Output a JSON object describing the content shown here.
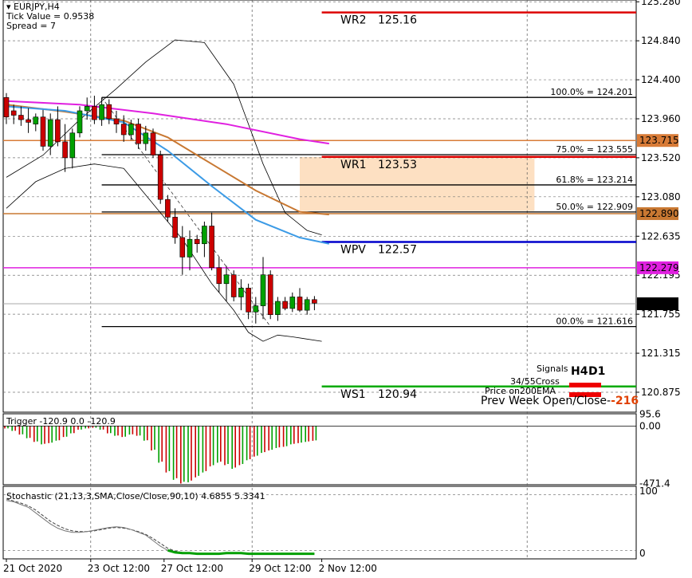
{
  "chart_data": {
    "type": "candlestick",
    "symbol": "EURJPY,H4",
    "tick_value_label": "Tick Value = 0.9538",
    "spread_label": "Spread = 7",
    "ylim": [
      120.65,
      125.3
    ],
    "price_ticks": [
      "125.280",
      "124.840",
      "124.400",
      "123.960",
      "123.520",
      "123.080",
      "122.635",
      "122.195",
      "121.755",
      "121.315",
      "120.875"
    ],
    "time_labels": [
      {
        "label": "21 Oct 2020",
        "x": 0
      },
      {
        "label": "23 Oct 12:00",
        "x": 11.5
      },
      {
        "label": "27 Oct 12:00",
        "x": 21.5
      },
      {
        "label": "29 Oct 12:00",
        "x": 33.5
      },
      {
        "label": "2 Nov 12:00",
        "x": 43
      }
    ],
    "vertical_gridlines_x": [
      11.5,
      33.5
    ],
    "candles": [
      {
        "o": 124.2,
        "h": 124.25,
        "l": 123.9,
        "c": 123.98
      },
      {
        "o": 124.05,
        "h": 124.12,
        "l": 123.9,
        "c": 124.0
      },
      {
        "o": 124.0,
        "h": 124.1,
        "l": 123.88,
        "c": 123.95
      },
      {
        "o": 123.95,
        "h": 124.08,
        "l": 123.8,
        "c": 123.92
      },
      {
        "o": 123.9,
        "h": 124.02,
        "l": 123.82,
        "c": 123.98
      },
      {
        "o": 123.98,
        "h": 124.06,
        "l": 123.6,
        "c": 123.65
      },
      {
        "o": 123.65,
        "h": 124.02,
        "l": 123.55,
        "c": 123.95
      },
      {
        "o": 123.95,
        "h": 124.1,
        "l": 123.65,
        "c": 123.7
      },
      {
        "o": 123.7,
        "h": 123.9,
        "l": 123.36,
        "c": 123.52
      },
      {
        "o": 123.52,
        "h": 123.85,
        "l": 123.4,
        "c": 123.8
      },
      {
        "o": 123.8,
        "h": 124.1,
        "l": 123.75,
        "c": 124.05
      },
      {
        "o": 124.05,
        "h": 124.2,
        "l": 123.95,
        "c": 124.1
      },
      {
        "o": 124.1,
        "h": 124.22,
        "l": 123.9,
        "c": 123.95
      },
      {
        "o": 123.95,
        "h": 124.2,
        "l": 123.88,
        "c": 124.12
      },
      {
        "o": 124.12,
        "h": 124.18,
        "l": 123.9,
        "c": 123.96
      },
      {
        "o": 123.96,
        "h": 124.05,
        "l": 123.8,
        "c": 123.9
      },
      {
        "o": 123.9,
        "h": 124.0,
        "l": 123.7,
        "c": 123.78
      },
      {
        "o": 123.78,
        "h": 123.95,
        "l": 123.72,
        "c": 123.9
      },
      {
        "o": 123.9,
        "h": 123.96,
        "l": 123.62,
        "c": 123.68
      },
      {
        "o": 123.68,
        "h": 123.88,
        "l": 123.6,
        "c": 123.8
      },
      {
        "o": 123.8,
        "h": 123.85,
        "l": 123.52,
        "c": 123.55
      },
      {
        "o": 123.55,
        "h": 123.6,
        "l": 123.0,
        "c": 123.05
      },
      {
        "o": 123.05,
        "h": 123.1,
        "l": 122.8,
        "c": 122.85
      },
      {
        "o": 122.85,
        "h": 122.95,
        "l": 122.55,
        "c": 122.62
      },
      {
        "o": 122.62,
        "h": 122.75,
        "l": 122.2,
        "c": 122.4
      },
      {
        "o": 122.4,
        "h": 122.7,
        "l": 122.25,
        "c": 122.6
      },
      {
        "o": 122.6,
        "h": 122.65,
        "l": 122.45,
        "c": 122.55
      },
      {
        "o": 122.55,
        "h": 122.8,
        "l": 122.4,
        "c": 122.75
      },
      {
        "o": 122.75,
        "h": 122.9,
        "l": 122.25,
        "c": 122.28
      },
      {
        "o": 122.28,
        "h": 122.4,
        "l": 122.0,
        "c": 122.1
      },
      {
        "o": 122.1,
        "h": 122.3,
        "l": 121.9,
        "c": 122.2
      },
      {
        "o": 122.2,
        "h": 122.25,
        "l": 121.9,
        "c": 121.95
      },
      {
        "o": 121.95,
        "h": 122.15,
        "l": 121.8,
        "c": 122.05
      },
      {
        "o": 122.05,
        "h": 122.1,
        "l": 121.7,
        "c": 121.78
      },
      {
        "o": 121.78,
        "h": 121.95,
        "l": 121.65,
        "c": 121.85
      },
      {
        "o": 121.85,
        "h": 122.4,
        "l": 121.7,
        "c": 122.2
      },
      {
        "o": 122.2,
        "h": 122.25,
        "l": 121.7,
        "c": 121.75
      },
      {
        "o": 121.75,
        "h": 121.95,
        "l": 121.68,
        "c": 121.9
      },
      {
        "o": 121.9,
        "h": 121.95,
        "l": 121.8,
        "c": 121.82
      },
      {
        "o": 121.82,
        "h": 122.0,
        "l": 121.78,
        "c": 121.95
      },
      {
        "o": 121.95,
        "h": 122.05,
        "l": 121.78,
        "c": 121.8
      },
      {
        "o": 121.8,
        "h": 121.95,
        "l": 121.75,
        "c": 121.92
      },
      {
        "o": 121.92,
        "h": 121.96,
        "l": 121.8,
        "c": 121.88
      }
    ],
    "moving_averages": [
      {
        "color": "#e020e0",
        "points": [
          [
            0,
            124.16
          ],
          [
            10,
            124.12
          ],
          [
            20,
            124.02
          ],
          [
            30,
            123.9
          ],
          [
            40,
            123.73
          ],
          [
            44,
            123.68
          ]
        ]
      },
      {
        "color": "#c87832",
        "points": [
          [
            0,
            124.12
          ],
          [
            8,
            124.04
          ],
          [
            16,
            123.94
          ],
          [
            22,
            123.75
          ],
          [
            28,
            123.45
          ],
          [
            34,
            123.15
          ],
          [
            40,
            122.91
          ],
          [
            44,
            122.88
          ]
        ]
      },
      {
        "color": "#3c9be6",
        "points": [
          [
            0,
            124.1
          ],
          [
            8,
            124.05
          ],
          [
            16,
            123.92
          ],
          [
            22,
            123.6
          ],
          [
            28,
            123.2
          ],
          [
            34,
            122.82
          ],
          [
            40,
            122.62
          ],
          [
            44,
            122.55
          ]
        ]
      }
    ],
    "envelope": [
      {
        "points": [
          [
            0,
            123.3
          ],
          [
            5,
            123.55
          ],
          [
            10,
            123.95
          ],
          [
            15,
            124.3
          ],
          [
            19,
            124.6
          ],
          [
            23,
            124.85
          ],
          [
            27,
            124.82
          ],
          [
            31,
            124.35
          ],
          [
            35,
            123.45
          ],
          [
            38,
            122.9
          ],
          [
            41,
            122.7
          ],
          [
            43,
            122.65
          ]
        ]
      },
      {
        "points": [
          [
            0,
            122.95
          ],
          [
            4,
            123.25
          ],
          [
            8,
            123.4
          ],
          [
            12,
            123.45
          ],
          [
            16,
            123.4
          ],
          [
            20,
            123.0
          ],
          [
            24,
            122.6
          ],
          [
            28,
            122.1
          ],
          [
            31,
            121.8
          ],
          [
            33,
            121.55
          ],
          [
            35,
            121.45
          ],
          [
            37,
            121.52
          ],
          [
            39,
            121.5
          ],
          [
            43,
            121.45
          ]
        ]
      }
    ],
    "fib_lines": [
      {
        "label": "100.0% = 124.201",
        "price": 124.201
      },
      {
        "label": "75.0% = 123.555",
        "price": 123.555
      },
      {
        "label": "61.8% = 123.214",
        "price": 123.214
      },
      {
        "label": "50.0% = 122.909",
        "price": 122.909
      },
      {
        "label": "00.0% = 121.616",
        "price": 121.616
      }
    ],
    "fib_x_range": [
      13,
      87
    ],
    "pivots": [
      {
        "label": "WR2",
        "value": "125.16",
        "price": 125.16,
        "color": "#dd0000"
      },
      {
        "label": "WR1",
        "value": "123.53",
        "price": 123.53,
        "color": "#dd0000"
      },
      {
        "label": "WPV",
        "value": "122.57",
        "price": 122.57,
        "color": "#0000cc"
      },
      {
        "label": "WS1",
        "value": "120.94",
        "price": 120.94,
        "color": "#00aa00"
      }
    ],
    "pivot_x_range": [
      43,
      87
    ],
    "zone": {
      "x_from": 40,
      "x_to": 72,
      "price_from": 122.92,
      "price_to": 123.53,
      "color": "#fde0c2"
    },
    "price_lines": [
      {
        "price": 123.715,
        "label": "123.715",
        "color": "#d87b37"
      },
      {
        "price": 122.89,
        "label": "122.890",
        "color": "#c87832"
      },
      {
        "price": 122.279,
        "label": "122.279",
        "color": "#e020e0"
      }
    ],
    "current_price": {
      "price": 121.873,
      "label": "121.873"
    },
    "signals": {
      "title": "Signals",
      "col_h4": "H4",
      "col_d1": "D1",
      "rows": [
        "34/55Cross",
        "Price on200EMA"
      ],
      "prev_week_label": "Prev Week Open/Close-",
      "prev_week_value": "-216"
    },
    "trigger": {
      "title": "Trigger -120.9 0.0 -120.9",
      "scale_top": "95.6",
      "scale_zero": "0.00",
      "scale_bottom": "-471.4",
      "ylim": [
        -480,
        100
      ],
      "values": [
        -20,
        -40,
        -70,
        -100,
        -130,
        -150,
        -140,
        -120,
        -90,
        -60,
        -30,
        -20,
        -15,
        -30,
        -60,
        -80,
        -90,
        -70,
        -80,
        -120,
        -200,
        -300,
        -380,
        -440,
        -470,
        -460,
        -420,
        -380,
        -330,
        -300,
        -320,
        -350,
        -320,
        -280,
        -250,
        -220,
        -200,
        -180,
        -170,
        -150,
        -140,
        -130,
        -121
      ]
    },
    "stochastic": {
      "title": "Stochastic (21,13,3,SMA,Close/Close,90,10) 4.6855 5.3341",
      "scale_top": "100",
      "scale_bottom": "0",
      "levels": [
        90,
        10
      ],
      "main": [
        82,
        80,
        76,
        72,
        64,
        56,
        48,
        42,
        38,
        36,
        36,
        37,
        39,
        41,
        43,
        44,
        43,
        40,
        36,
        32,
        24,
        16,
        10,
        7,
        6,
        6,
        5,
        5,
        5,
        5,
        6,
        6,
        6,
        5,
        5,
        5,
        5,
        5,
        5,
        5,
        5,
        5,
        5
      ],
      "signal": [
        84,
        81,
        78,
        74,
        68,
        60,
        52,
        46,
        41,
        38,
        37,
        37,
        38,
        40,
        42,
        43,
        42,
        40,
        37,
        33,
        27,
        20,
        13,
        9,
        7,
        6,
        6,
        5,
        5,
        5,
        5,
        6,
        6,
        6,
        5,
        5,
        5,
        5,
        5,
        5,
        5,
        5,
        5
      ]
    },
    "colors": {
      "bull": "#00a000",
      "bear": "#cc0000",
      "grid": "#000000"
    }
  }
}
